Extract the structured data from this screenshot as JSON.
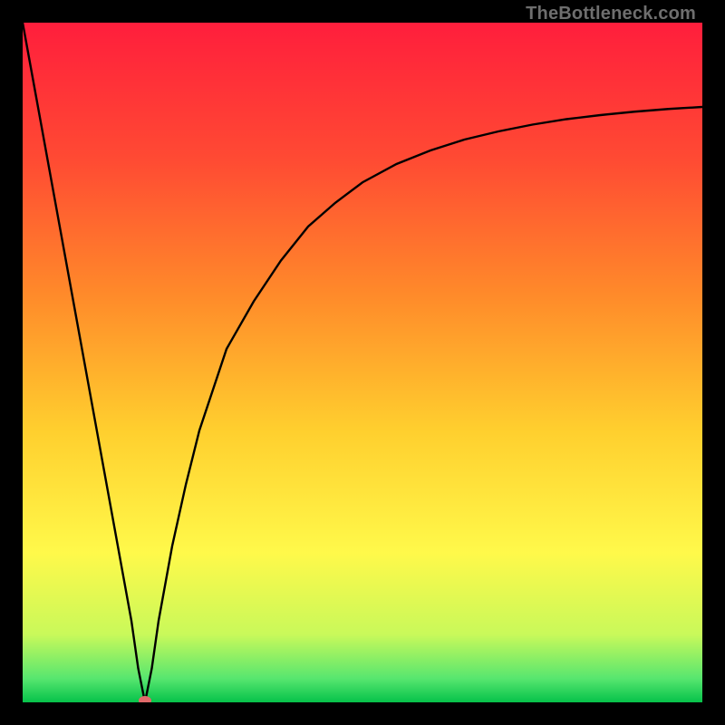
{
  "watermark": "TheBottleneck.com",
  "chart_data": {
    "type": "line",
    "title": "",
    "xlabel": "",
    "ylabel": "",
    "xlim": [
      0,
      100
    ],
    "ylim": [
      0,
      100
    ],
    "grid": false,
    "legend": false,
    "note": "V-shaped bottleneck curve on a vertical red→orange→yellow→green gradient. x approximates GPU-relative-to-CPU percentage; y approximates bottleneck percentage. Minimum near x≈18, y≈0.",
    "background_gradient_stops": [
      {
        "pos": 0.0,
        "color": "#ff1e3c"
      },
      {
        "pos": 0.2,
        "color": "#ff4a33"
      },
      {
        "pos": 0.4,
        "color": "#ff8a2a"
      },
      {
        "pos": 0.6,
        "color": "#ffcf2e"
      },
      {
        "pos": 0.78,
        "color": "#fff94a"
      },
      {
        "pos": 0.9,
        "color": "#c9f95a"
      },
      {
        "pos": 0.965,
        "color": "#57e66f"
      },
      {
        "pos": 1.0,
        "color": "#06c24a"
      }
    ],
    "series": [
      {
        "name": "bottleneck-curve",
        "x": [
          0,
          2,
          4,
          6,
          8,
          10,
          12,
          14,
          16,
          17,
          18,
          19,
          20,
          22,
          24,
          26,
          28,
          30,
          34,
          38,
          42,
          46,
          50,
          55,
          60,
          65,
          70,
          75,
          80,
          85,
          90,
          95,
          100
        ],
        "y": [
          100,
          89,
          78,
          67,
          56,
          45,
          34,
          23,
          12,
          5,
          0,
          5,
          12,
          23,
          32,
          40,
          46,
          52,
          59,
          65,
          70,
          73.5,
          76.5,
          79.2,
          81.2,
          82.8,
          84,
          85,
          85.8,
          86.4,
          86.9,
          87.3,
          87.6
        ]
      }
    ],
    "min_marker": {
      "x": 18,
      "y": 0,
      "color": "#e06a6a"
    }
  }
}
